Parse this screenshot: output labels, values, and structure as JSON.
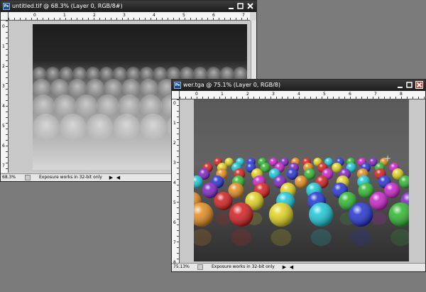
{
  "window1": {
    "title": "untitled.tif @ 68.3% (Layer 0, RGB/8#)",
    "zoom": "68.3%",
    "status_info": "Exposure works in 32-bit only",
    "ruler_numbers_left": [
      "0",
      "1",
      "2",
      "3",
      "4",
      "5",
      "6",
      "7"
    ],
    "ruler_numbers_top": [
      "0",
      "1",
      "2",
      "3",
      "4",
      "5",
      "6",
      "7"
    ]
  },
  "window2": {
    "title": "wer.tga @ 75.1% (Layer 0, RGB/8)",
    "zoom": "75.13%",
    "status_info": "Exposure works in 32-bit only",
    "ruler_numbers_left": [
      "0",
      "1",
      "2",
      "3",
      "4",
      "5",
      "6",
      "7",
      "8"
    ],
    "ruler_numbers_top": [
      "0",
      "1",
      "2",
      "3",
      "4",
      "5",
      "6",
      "7",
      "8",
      "9"
    ]
  },
  "icons": {
    "app": "photoshop-icon",
    "minimize": "minimize-icon",
    "maximize": "maximize-icon",
    "close": "close-icon"
  },
  "colors": {
    "desktop": "#7b7b7b",
    "titlebar": "#1c1c1c",
    "close_button": "#c93c2a",
    "ball_colors": [
      "#d21a1a",
      "#e0d21a",
      "#17c6d6",
      "#1f2fd0",
      "#2ab52a",
      "#c71ec7",
      "#7a1ec2",
      "#e28a1a"
    ]
  }
}
